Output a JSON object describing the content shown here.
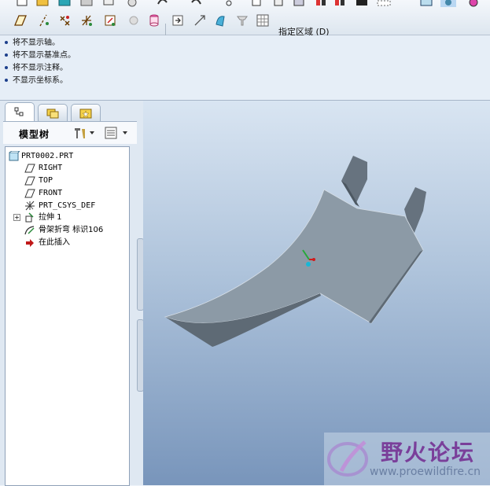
{
  "toolbar": {
    "region_label": "指定区域 (D)",
    "row1_icons": [
      "new-icon",
      "open-icon",
      "save-icon",
      "print-icon",
      "email-icon",
      "undo-icon",
      "redo-icon",
      "cut-icon",
      "copy-icon",
      "paste-icon",
      "paste-special-icon",
      "regenerate-icon",
      "find-icon",
      "repaint-icon",
      "view-icon",
      "orient-icon",
      "spin-icon"
    ],
    "row2_icons": [
      "datum-plane-icon",
      "datum-axis-icon",
      "datum-point-icon",
      "coord-sys-icon",
      "sketch-icon",
      "disabled-icon",
      "cylinder-icon",
      "insert-icon",
      "select-icon",
      "smart-select-icon",
      "pin-icon",
      "grid-icon"
    ]
  },
  "messages": [
    "将不显示轴。",
    "将不显示基准点。",
    "将不显示注释。",
    "不显示坐标系。"
  ],
  "navigator": {
    "tabs": [
      "model-tree-tab",
      "folder-browser-tab",
      "favorites-tab"
    ],
    "title": "模型树",
    "tree": [
      {
        "label": "PRT0002.PRT",
        "icon": "part-icon"
      },
      {
        "label": "RIGHT",
        "icon": "datum-plane-icon"
      },
      {
        "label": "TOP",
        "icon": "datum-plane-icon"
      },
      {
        "label": "FRONT",
        "icon": "datum-plane-icon"
      },
      {
        "label": "PRT_CSYS_DEF",
        "icon": "coord-sys-icon"
      },
      {
        "label": "拉伸 1",
        "icon": "extrude-icon"
      },
      {
        "label": "骨架折弯 标识106",
        "icon": "spinal-bend-icon"
      },
      {
        "label": "在此插入",
        "icon": "insert-here-arrow-icon"
      }
    ]
  },
  "watermark": {
    "title": "野火论坛",
    "url": "www.proewildfire.cn"
  },
  "colors": {
    "part_surface": "#8c9aa6",
    "viewport_top": "#d9e5f2",
    "viewport_bottom": "#7895bb",
    "csys_x": "#d01c1c",
    "csys_y": "#27a83a",
    "csys_z": "#18b7d6"
  }
}
